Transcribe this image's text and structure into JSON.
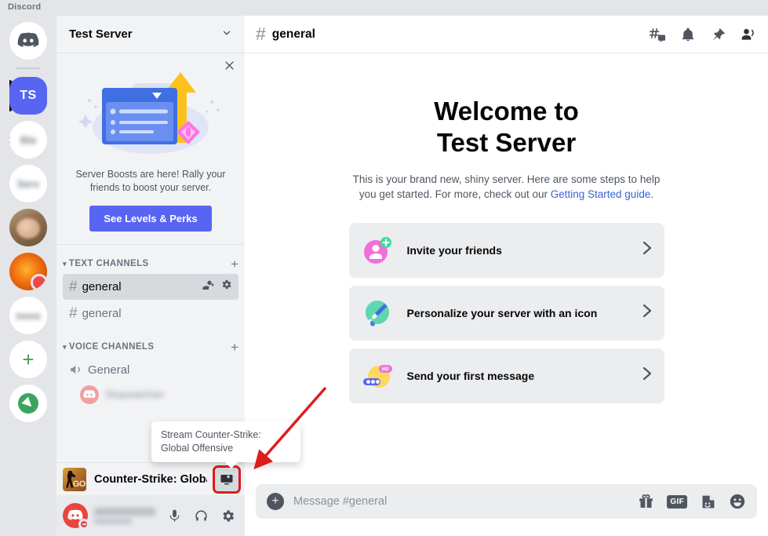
{
  "titlebar": {
    "app_name": "Discord"
  },
  "guild_rail": {
    "items": [
      {
        "name": "discord-home",
        "label": ""
      },
      {
        "name": "test-server",
        "label": "TS",
        "selected": true
      },
      {
        "name": "server-2",
        "label": ""
      },
      {
        "name": "server-3",
        "label": ""
      },
      {
        "name": "server-4",
        "label": ""
      },
      {
        "name": "server-5",
        "label": ""
      },
      {
        "name": "server-6",
        "label": ""
      }
    ],
    "add_server_label": "+",
    "explore_label": "explore-icon"
  },
  "sidebar": {
    "server_name": "Test Server",
    "server_dropdown_icon": "chevron-down-icon",
    "boost": {
      "close_icon": "close-icon",
      "text": "Server Boosts are here! Rally your friends to boost your server.",
      "button_label": "See Levels & Perks"
    },
    "categories": [
      {
        "label": "TEXT CHANNELS",
        "add_label": "+",
        "channels": [
          {
            "name": "general",
            "active": true,
            "actions": [
              "create-invite-icon",
              "edit-channel-icon"
            ]
          },
          {
            "name": "general",
            "active": false,
            "actions": []
          }
        ]
      },
      {
        "label": "VOICE CHANNELS",
        "add_label": "+",
        "channels": [
          {
            "name": "General",
            "active": false,
            "actions": []
          }
        ]
      }
    ],
    "voice_member": {
      "name": ""
    },
    "gamebar": {
      "game_name": "Counter-Strike: Global ...",
      "game_icon": "csgo-icon",
      "stream_icon": "stream-screen-icon",
      "highlighted": true
    },
    "tooltip": {
      "text": "Stream Counter-Strike: Global Offensive"
    },
    "user_panel": {
      "username": "",
      "tag": "",
      "status": "dnd",
      "actions": [
        "microphone-icon",
        "headphones-icon",
        "user-settings-gear-icon"
      ]
    }
  },
  "main": {
    "channel_header": {
      "hash": "#",
      "title": "general",
      "icons": [
        "threads-icon",
        "notifications-bell-icon",
        "pinned-messages-icon",
        "member-list-icon"
      ]
    },
    "welcome": {
      "title_line1": "Welcome to",
      "title_line2": "Test Server",
      "subtitle_before": "This is your brand new, shiny server. Here are some steps to help you get started. For more, check out our ",
      "subtitle_link": "Getting Started guide",
      "subtitle_after": "."
    },
    "cards": [
      {
        "label": "Invite your friends",
        "icon": "invite-friends-icon",
        "chevron": "›"
      },
      {
        "label": "Personalize your server with an icon",
        "icon": "paintbrush-icon",
        "chevron": "›"
      },
      {
        "label": "Send your first message",
        "icon": "chat-bubble-icon",
        "chevron": "›"
      }
    ],
    "message_box": {
      "add_icon": "add-attachment-icon",
      "placeholder": "Message #general",
      "actions": [
        "gift-icon",
        "GIF",
        "sticker-icon",
        "emoji-icon"
      ]
    }
  },
  "annotation": {
    "arrow_color": "#e01b1b",
    "highlight_color": "#e01b1b"
  }
}
